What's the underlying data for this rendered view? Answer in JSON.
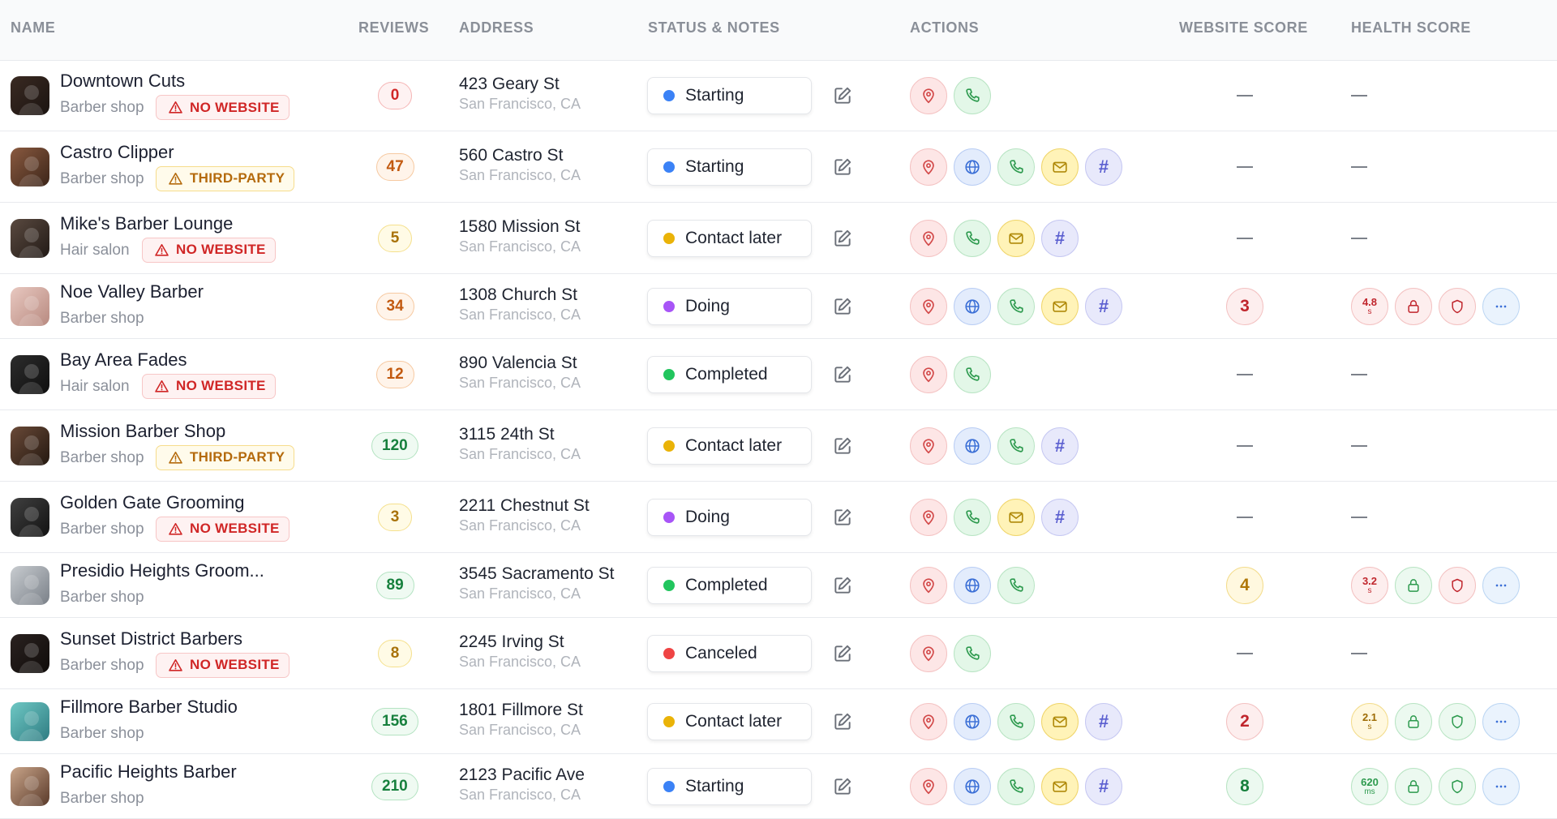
{
  "columns": {
    "name": "NAME",
    "reviews": "REVIEWS",
    "address": "ADDRESS",
    "status": "STATUS & NOTES",
    "actions": "ACTIONS",
    "website_score": "WEBSITE SCORE",
    "health_score": "HEALTH SCORE"
  },
  "colors": {
    "starting": "#3b82f6",
    "contact_later": "#eab308",
    "doing": "#a855f7",
    "completed": "#22c55e",
    "canceled": "#ef4444"
  },
  "rows": [
    {
      "name": "Downtown Cuts",
      "category": "Barber shop",
      "badge": "NO WEBSITE",
      "reviews": "0",
      "street": "423 Geary St",
      "city": "San Francisco, CA",
      "status": "Starting",
      "actions": [
        "map",
        "phone"
      ],
      "website_score": "—",
      "health": null
    },
    {
      "name": "Castro Clipper",
      "category": "Barber shop",
      "badge": "THIRD-PARTY",
      "reviews": "47",
      "street": "560 Castro St",
      "city": "San Francisco, CA",
      "status": "Starting",
      "actions": [
        "map",
        "web",
        "phone",
        "mail",
        "hash"
      ],
      "website_score": "—",
      "health": null
    },
    {
      "name": "Mike's Barber Lounge",
      "category": "Hair salon",
      "badge": "NO WEBSITE",
      "reviews": "5",
      "street": "1580 Mission St",
      "city": "San Francisco, CA",
      "status": "Contact later",
      "actions": [
        "map",
        "phone",
        "mail",
        "hash"
      ],
      "website_score": "—",
      "health": null
    },
    {
      "name": "Noe Valley Barber",
      "category": "Barber shop",
      "badge": "",
      "reviews": "34",
      "street": "1308 Church St",
      "city": "San Francisco, CA",
      "status": "Doing",
      "actions": [
        "map",
        "web",
        "phone",
        "mail",
        "hash"
      ],
      "website_score": "3",
      "health": {
        "speed": "4.8",
        "unit": "s",
        "speed_color": "red",
        "lock_color": "red",
        "shield_color": "red"
      }
    },
    {
      "name": "Bay Area Fades",
      "category": "Hair salon",
      "badge": "NO WEBSITE",
      "reviews": "12",
      "street": "890 Valencia St",
      "city": "San Francisco, CA",
      "status": "Completed",
      "actions": [
        "map",
        "phone"
      ],
      "website_score": "—",
      "health": null
    },
    {
      "name": "Mission Barber Shop",
      "category": "Barber shop",
      "badge": "THIRD-PARTY",
      "reviews": "120",
      "street": "3115 24th St",
      "city": "San Francisco, CA",
      "status": "Contact later",
      "actions": [
        "map",
        "web",
        "phone",
        "hash"
      ],
      "website_score": "—",
      "health": null
    },
    {
      "name": "Golden Gate Grooming",
      "category": "Barber shop",
      "badge": "NO WEBSITE",
      "reviews": "3",
      "street": "2211 Chestnut St",
      "city": "San Francisco, CA",
      "status": "Doing",
      "actions": [
        "map",
        "phone",
        "mail",
        "hash"
      ],
      "website_score": "—",
      "health": null
    },
    {
      "name": "Presidio Heights Groom...",
      "category": "Barber shop",
      "badge": "",
      "reviews": "89",
      "street": "3545 Sacramento St",
      "city": "San Francisco, CA",
      "status": "Completed",
      "actions": [
        "map",
        "web",
        "phone"
      ],
      "website_score": "4",
      "health": {
        "speed": "3.2",
        "unit": "s",
        "speed_color": "red",
        "lock_color": "green",
        "shield_color": "red"
      }
    },
    {
      "name": "Sunset District Barbers",
      "category": "Barber shop",
      "badge": "NO WEBSITE",
      "reviews": "8",
      "street": "2245 Irving St",
      "city": "San Francisco, CA",
      "status": "Canceled",
      "actions": [
        "map",
        "phone"
      ],
      "website_score": "—",
      "health": null
    },
    {
      "name": "Fillmore Barber Studio",
      "category": "Barber shop",
      "badge": "",
      "reviews": "156",
      "street": "1801 Fillmore St",
      "city": "San Francisco, CA",
      "status": "Contact later",
      "actions": [
        "map",
        "web",
        "phone",
        "mail",
        "hash"
      ],
      "website_score": "2",
      "health": {
        "speed": "2.1",
        "unit": "s",
        "speed_color": "yellow",
        "lock_color": "green",
        "shield_color": "green"
      }
    },
    {
      "name": "Pacific Heights Barber",
      "category": "Barber shop",
      "badge": "",
      "reviews": "210",
      "street": "2123 Pacific Ave",
      "city": "San Francisco, CA",
      "status": "Starting",
      "actions": [
        "map",
        "web",
        "phone",
        "mail",
        "hash"
      ],
      "website_score": "8",
      "health": {
        "speed": "620",
        "unit": "ms",
        "speed_color": "green",
        "lock_color": "green",
        "shield_color": "green"
      }
    }
  ]
}
